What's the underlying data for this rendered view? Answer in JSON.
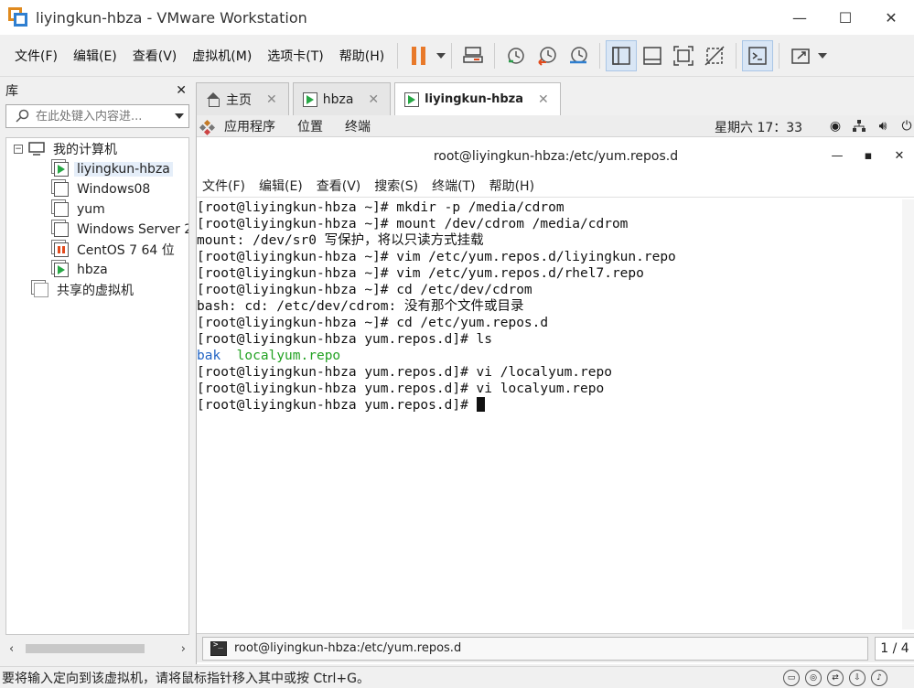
{
  "window": {
    "title": "liyingkun-hbza - VMware Workstation"
  },
  "menu": [
    {
      "label": "文件(F)"
    },
    {
      "label": "编辑(E)"
    },
    {
      "label": "查看(V)"
    },
    {
      "label": "虚拟机(M)"
    },
    {
      "label": "选项卡(T)"
    },
    {
      "label": "帮助(H)"
    }
  ],
  "library": {
    "title": "库",
    "search_placeholder": "在此处键入内容进...",
    "root": "我的计算机",
    "vms": [
      "liyingkun-hbza",
      "Windows08",
      "yum",
      "Windows Server 2",
      "CentOS 7 64 位",
      "hbza"
    ],
    "shared": "共享的虚拟机"
  },
  "tabs": [
    {
      "label": "主页"
    },
    {
      "label": "hbza"
    },
    {
      "label": "liyingkun-hbza"
    }
  ],
  "guest": {
    "top_menu": [
      "应用程序",
      "位置",
      "终端"
    ],
    "clock": "星期六 17：33",
    "terminal_title": "root@liyingkun-hbza:/etc/yum.repos.d",
    "terminal_menu": [
      "文件(F)",
      "编辑(E)",
      "查看(V)",
      "搜索(S)",
      "终端(T)",
      "帮助(H)"
    ],
    "lines": [
      "[root@liyingkun-hbza ~]# mkdir -p /media/cdrom",
      "[root@liyingkun-hbza ~]# mount /dev/cdrom /media/cdrom",
      "mount: /dev/sr0 写保护，将以只读方式挂载",
      "[root@liyingkun-hbza ~]# vim /etc/yum.repos.d/liyingkun.repo",
      "[root@liyingkun-hbza ~]# vim /etc/yum.repos.d/rhel7.repo",
      "[root@liyingkun-hbza ~]# cd /etc/dev/cdrom",
      "bash: cd: /etc/dev/cdrom: 没有那个文件或目录",
      "[root@liyingkun-hbza ~]# cd /etc/yum.repos.d"
    ],
    "ls_prompt": "[root@liyingkun-hbza yum.repos.d]# ls",
    "ls_dir": "bak",
    "ls_file": "localyum.repo",
    "lines_after": [
      "[root@liyingkun-hbza yum.repos.d]# vi /localyum.repo",
      "[root@liyingkun-hbza yum.repos.d]# vi localyum.repo"
    ],
    "current_prompt": "[root@liyingkun-hbza yum.repos.d]# ",
    "taskbar_item": "root@liyingkun-hbza:/etc/yum.repos.d",
    "workspace": "1 / 4"
  },
  "statusbar": {
    "message": "要将输入定向到该虚拟机，请将鼠标指针移入其中或按 Ctrl+G。"
  },
  "colors": {
    "dir": "#2264c4",
    "file": "#23a223",
    "pause": "#e24a1c"
  }
}
